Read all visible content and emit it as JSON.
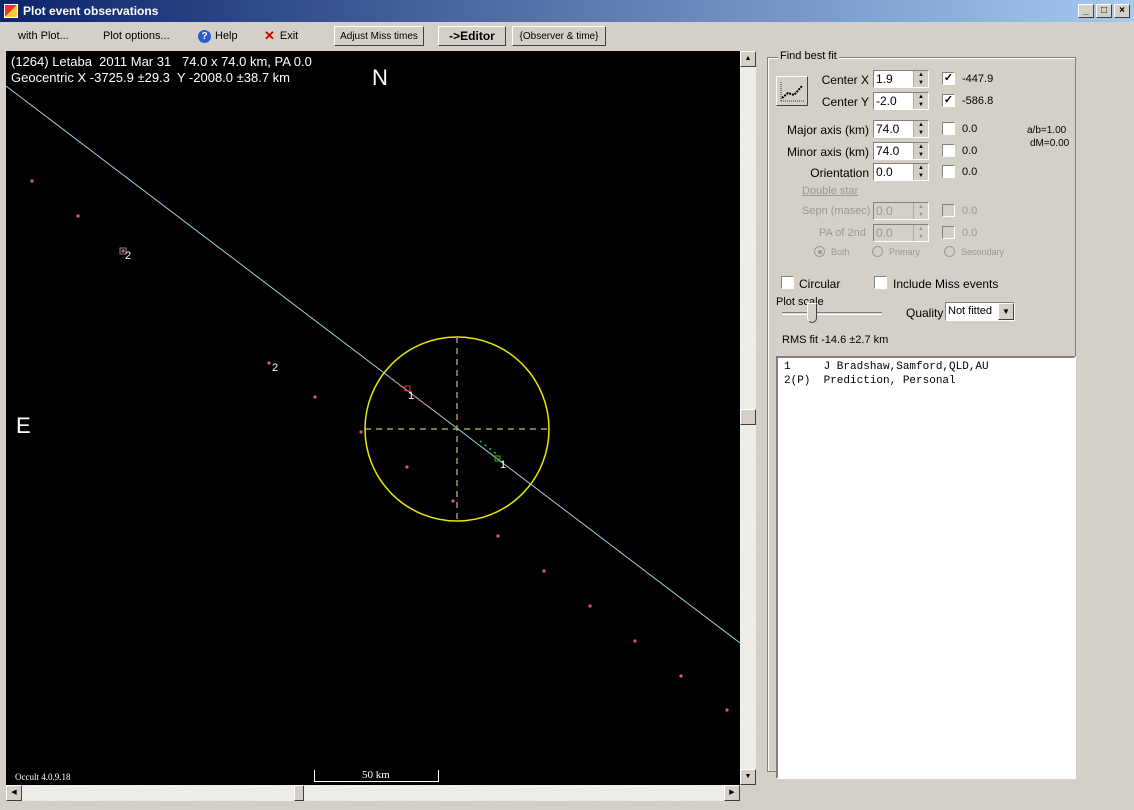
{
  "window": {
    "title": "Plot event observations",
    "controls": [
      "_",
      "□",
      "×"
    ]
  },
  "toolbar": {
    "with_plot": "with Plot...",
    "plot_options": "Plot options...",
    "help": "Help",
    "help_icon": "?",
    "exit": "Exit",
    "exit_icon": "✕",
    "adjust_miss": "Adjust Miss times",
    "editor": "->Editor",
    "observer_time": "{Observer & time}"
  },
  "plot": {
    "header_line1": "(1264) Letaba  2011 Mar 31   74.0 x 74.0 km, PA 0.0",
    "header_line2": "Geocentric X -3725.9 ±29.3  Y -2008.0 ±38.7 km",
    "north": "N",
    "east": "E",
    "version": "Occult 4.0.9.18",
    "scale_label": "50 km",
    "colors": {
      "background": "#000000",
      "ellipse": "#e8e800",
      "chord": "#9ecfe0",
      "prediction": "#e0509a",
      "disappear": "#e03030",
      "reappear": "#20c020"
    },
    "chord_labels": [
      {
        "text": "1",
        "kind": "disappear"
      },
      {
        "text": "1",
        "kind": "reappear"
      },
      {
        "text": "2",
        "kind": "prediction"
      },
      {
        "text": "2",
        "kind": "prediction"
      }
    ]
  },
  "fit": {
    "group_label": "Find best fit",
    "rows": [
      {
        "label": "Center X",
        "value": "1.9",
        "checked": true,
        "result": "-447.9"
      },
      {
        "label": "Center Y",
        "value": "-2.0",
        "checked": true,
        "result": "-586.8"
      },
      {
        "label": "Major axis (km)",
        "value": "74.0",
        "checked": false,
        "result": "0.0"
      },
      {
        "label": "Minor axis (km)",
        "value": "74.0",
        "checked": false,
        "result": "0.0"
      },
      {
        "label": "Orientation",
        "value": "0.0",
        "checked": false,
        "result": "0.0"
      }
    ],
    "ratio": "a/b=1.00",
    "dm": "dM=0.00",
    "double_star": "Double star",
    "sepn": {
      "label": "Sepn (masec)",
      "value": "0.0",
      "result": "0.0"
    },
    "pa2": {
      "label": "PA of 2nd",
      "value": "0.0",
      "result": "0.0"
    },
    "radios": [
      {
        "label": "Both",
        "selected": true
      },
      {
        "label": "Primary",
        "selected": false
      },
      {
        "label": "Secondary",
        "selected": false
      }
    ],
    "circular": "Circular",
    "include_miss": "Include Miss events",
    "plot_scale": "Plot scale",
    "plot_scale_value": 0.3,
    "quality_label": "Quality",
    "quality_value": "Not fitted",
    "rms": "RMS fit -14.6 ±2.7 km"
  },
  "observers": [
    "1     J Bradshaw,Samford,QLD,AU",
    "2(P)  Prediction, Personal"
  ]
}
